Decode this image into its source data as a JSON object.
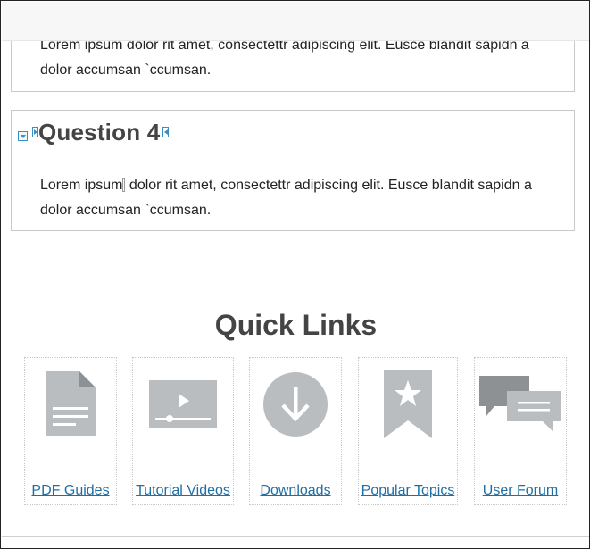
{
  "questions": [
    {
      "title": "",
      "body_before": "Lorem ipsum dolor rit amet, consectettr adipiscing elit. Eusce blandit sapidn a dolor accumsan `ccumsan.",
      "body_after": ""
    },
    {
      "title": "Question 4",
      "body_before": "Lorem ipsum",
      "body_after": " dolor rit amet, consectettr adipiscing elit. Eusce blandit sapidn a dolor accumsan `ccumsan."
    }
  ],
  "quick_links": {
    "title": "Quick Links",
    "items": [
      {
        "label": "PDF Guides",
        "icon": "document-icon"
      },
      {
        "label": "Tutorial Videos",
        "icon": "video-player-icon"
      },
      {
        "label": "Downloads",
        "icon": "download-icon"
      },
      {
        "label": "Popular Topics",
        "icon": "bookmark-star-icon"
      },
      {
        "label": "User Forum",
        "icon": "chat-bubbles-icon"
      }
    ]
  },
  "colors": {
    "link": "#1f6fa5",
    "icon_gray": "#b9bdbf",
    "icon_dark": "#8d9194",
    "heading": "#444444",
    "editor_marker": "#3a8fc0"
  }
}
